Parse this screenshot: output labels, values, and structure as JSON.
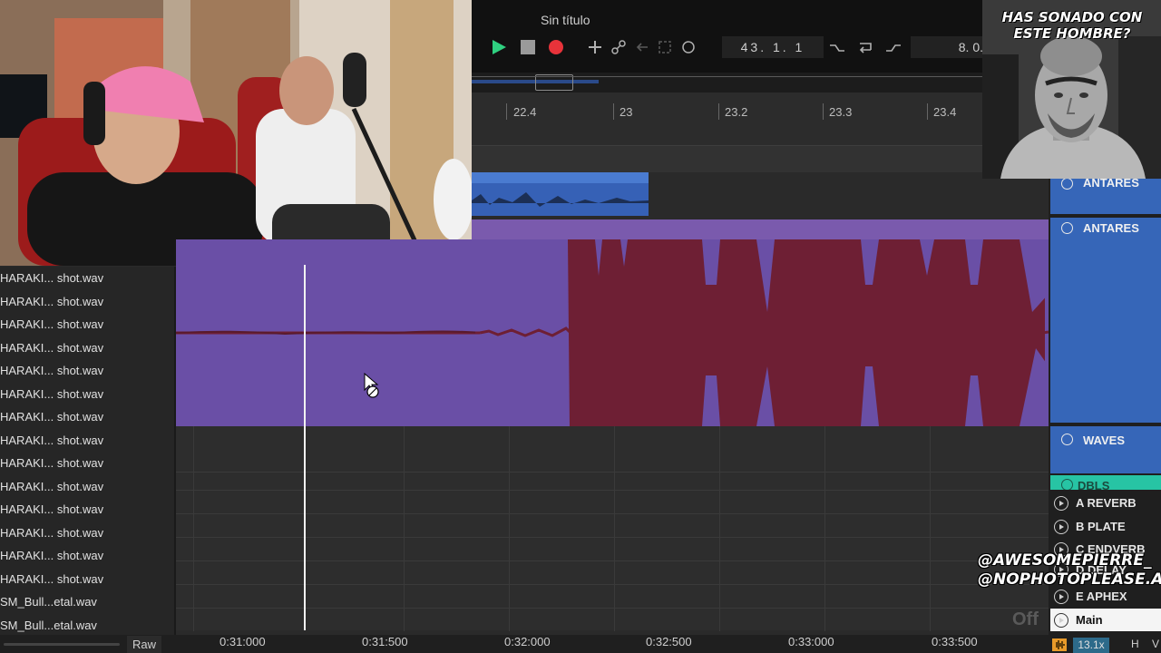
{
  "app": {
    "document_title": "Sin título"
  },
  "transport": {
    "position": "43. 1. 1",
    "tempo_partial": "8. 0."
  },
  "ruler": {
    "labels": [
      "22.4",
      "23",
      "23.2",
      "23.3",
      "23.4"
    ]
  },
  "tracks": [
    "HARAKI... shot.wav",
    "HARAKI... shot.wav",
    "HARAKI... shot.wav",
    "HARAKI... shot.wav",
    "HARAKI... shot.wav",
    "HARAKI... shot.wav",
    "HARAKI... shot.wav",
    "HARAKI... shot.wav",
    "HARAKI... shot.wav",
    "HARAKI... shot.wav",
    "HARAKI... shot.wav",
    "HARAKI... shot.wav",
    "HARAKI... shot.wav",
    "HARAKI... shot.wav",
    "SM_Bull...etal.wav",
    "SM_Bull...etal.wav"
  ],
  "raw_button": "Raw",
  "time_axis": [
    "0:31:000",
    "0:31:500",
    "0:32:000",
    "0:32:500",
    "0:33:000",
    "0:33:500"
  ],
  "right_panel": {
    "groups": [
      "ANTARES",
      "ANTARES",
      "WAVES",
      "DBLS"
    ],
    "returns": [
      "A REVERB",
      "B PLATE",
      "C ENDVERB",
      "D DELAY",
      "E APHEX"
    ],
    "main": "Main",
    "zoom": "13.1x",
    "h_label": "H",
    "v_label": "V"
  },
  "off_label": "Off",
  "overlay": {
    "caption": "HAS SONADO CON ESTE HOMBRE?",
    "handle_1": "@AWESOMEPIERRE_",
    "handle_2": "@NOPHOTOPLEASE.ALS"
  },
  "colors": {
    "clip_purple": "#6a4fa6",
    "waveform_red": "#6e1f34",
    "clip_blue": "#3661b6",
    "dbls_green": "#27c4a4",
    "play_green": "#2fd080",
    "record_red": "#e8333a"
  }
}
